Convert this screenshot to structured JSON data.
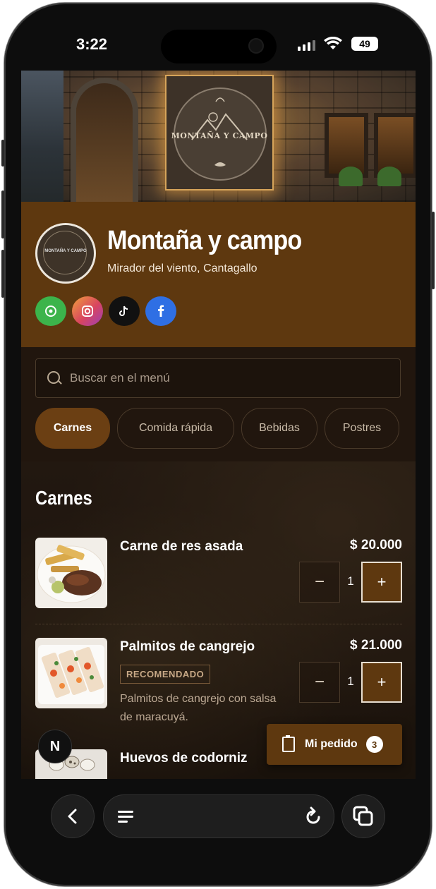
{
  "status_bar": {
    "time": "3:22",
    "battery": "49"
  },
  "restaurant": {
    "name": "Montaña y campo",
    "location": "Mirador del viento, Cantagallo",
    "sign_text": "MONTAÑA Y CAMPO",
    "avatar_text": "MONTAÑA Y CAMPO"
  },
  "social": [
    {
      "name": "WhatsApp",
      "icon": "whatsapp-icon",
      "color": "#3cb44b",
      "glyph": "◔"
    },
    {
      "name": "Instagram",
      "icon": "instagram-icon",
      "color": "#d9455f",
      "glyph": "◎"
    },
    {
      "name": "TikTok",
      "icon": "tiktok-icon",
      "color": "#111111",
      "glyph": "♪"
    },
    {
      "name": "Facebook",
      "icon": "facebook-icon",
      "color": "#2f6fe4",
      "glyph": "f"
    }
  ],
  "search": {
    "placeholder": "Buscar en el menú"
  },
  "tabs": [
    {
      "label": "Carnes",
      "active": true
    },
    {
      "label": "Comida rápida",
      "active": false
    },
    {
      "label": "Bebidas",
      "active": false
    },
    {
      "label": "Postres",
      "active": false
    }
  ],
  "section": {
    "title": "Carnes"
  },
  "items": [
    {
      "name": "Carne de res asada",
      "price": "$ 20.000",
      "qty": "1",
      "minus": "−",
      "plus": "+"
    },
    {
      "name": "Palmitos de cangrejo",
      "price": "$ 21.000",
      "badge": "RECOMENDADO",
      "description": "Palmitos de cangrejo con salsa de maracuyá.",
      "qty": "1",
      "minus": "−",
      "plus": "+"
    },
    {
      "name": "Huevos de codorniz"
    }
  ],
  "order_button": {
    "label": "Mi pedido",
    "count": "3"
  },
  "floating": {
    "letter": "N"
  },
  "colors": {
    "brand_brown": "#5e380f",
    "background": "#1a120c"
  }
}
